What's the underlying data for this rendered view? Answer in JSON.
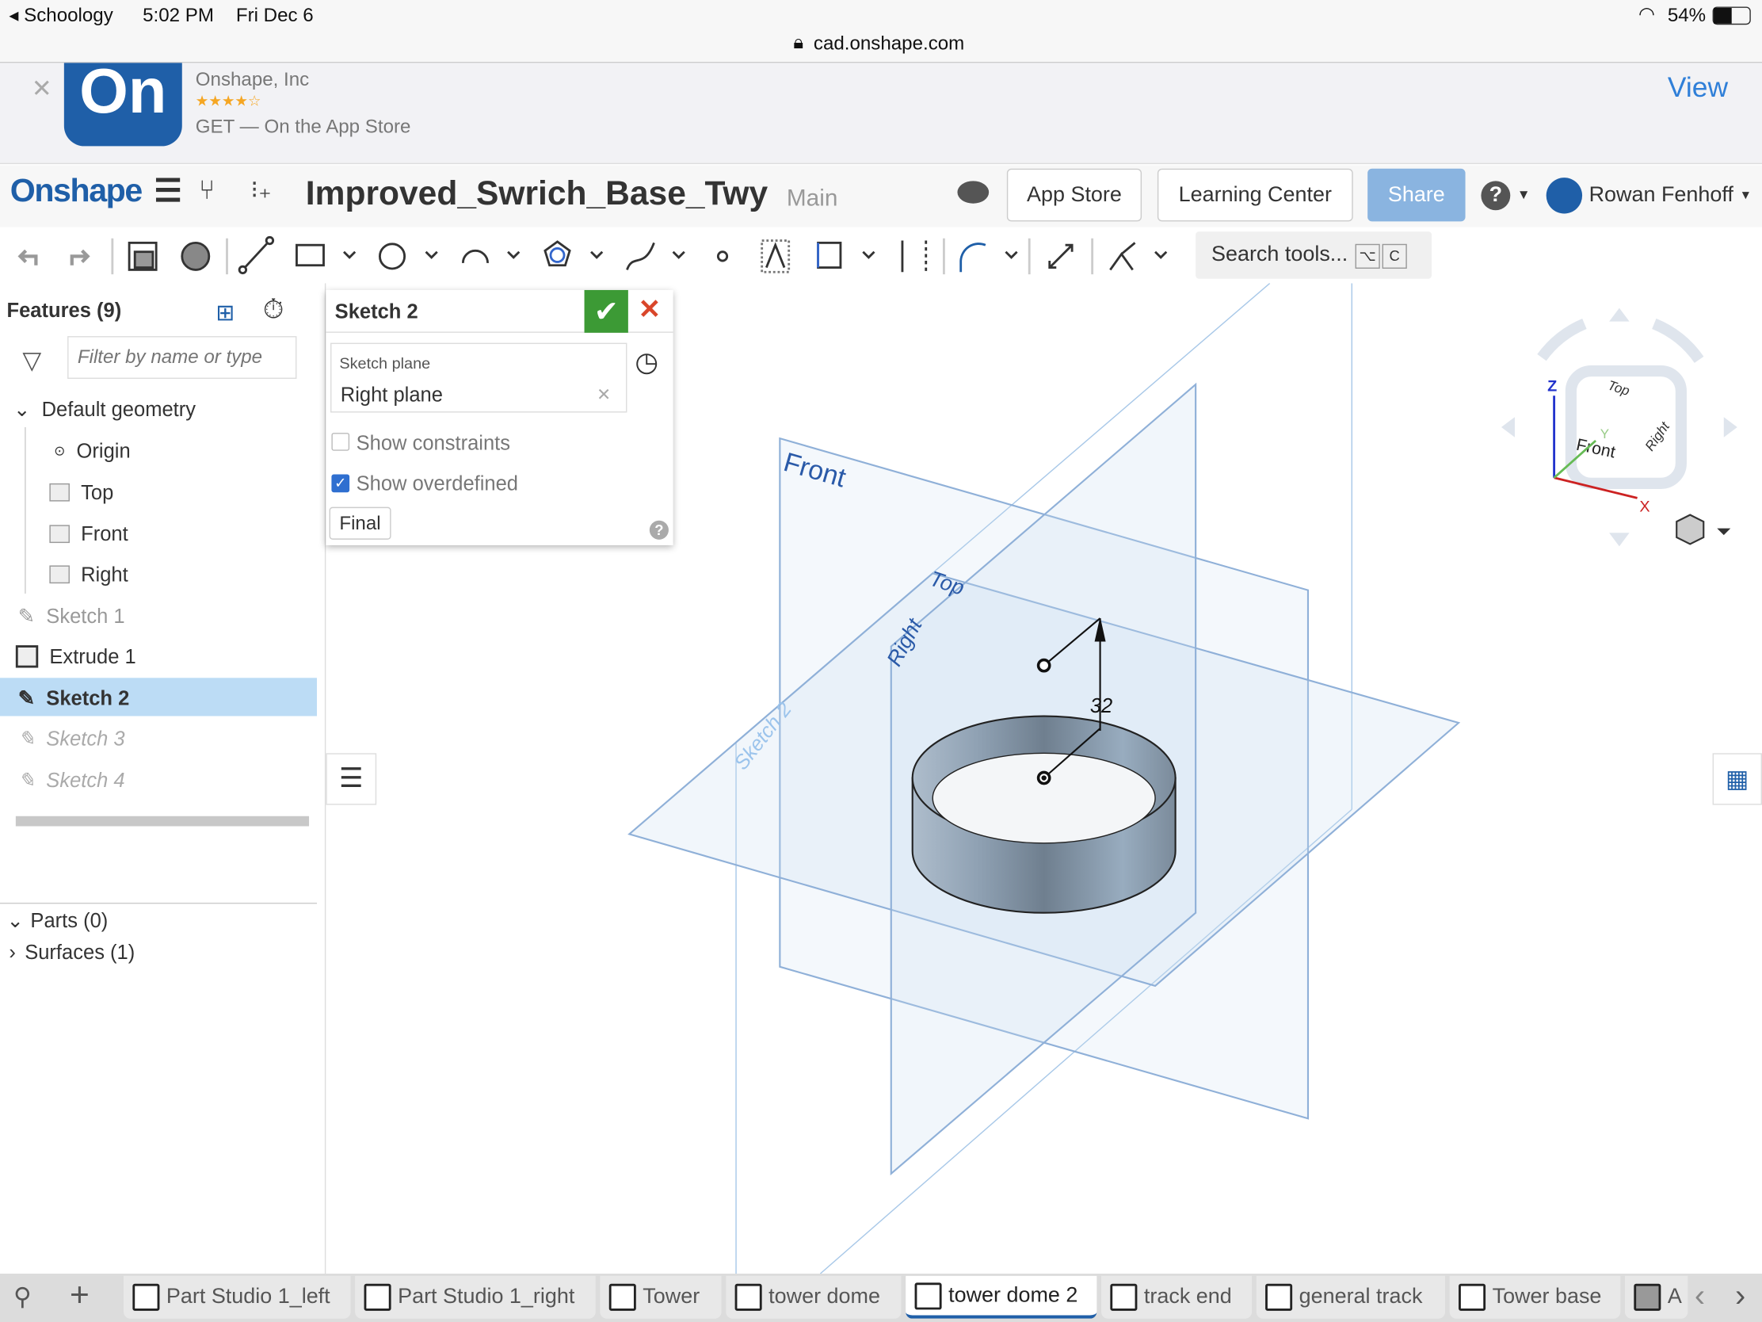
{
  "status_bar": {
    "back_app": "◂ Schoology",
    "time": "5:02 PM",
    "date": "Fri Dec 6",
    "battery": "54%",
    "url": "cad.onshape.com"
  },
  "banner": {
    "app_name": "Onshape, Inc",
    "rating_stars": "★★★★☆",
    "rating": 3.5,
    "subtitle": "GET — On the App Store",
    "view": "View",
    "icon_text": "On"
  },
  "header": {
    "logo": "Onshape",
    "title": "Improved_Swrich_Base_Twy",
    "branch": "Main",
    "app_store": "App Store",
    "learning_center": "Learning Center",
    "share": "Share",
    "user": "Rowan Fenhoff"
  },
  "toolbar": {
    "search": "Search tools...",
    "shortcut_alt": "⌥",
    "shortcut_key": "C"
  },
  "features": {
    "title": "Features (9)",
    "filter_placeholder": "Filter by name or type",
    "items": [
      {
        "label": "Default geometry"
      },
      {
        "label": "Origin"
      },
      {
        "label": "Top"
      },
      {
        "label": "Front"
      },
      {
        "label": "Right"
      },
      {
        "label": "Sketch 1"
      },
      {
        "label": "Extrude 1"
      },
      {
        "label": "Sketch 2"
      },
      {
        "label": "Sketch 3"
      },
      {
        "label": "Sketch 4"
      }
    ],
    "parts": "Parts (0)",
    "surfaces": "Surfaces (1)"
  },
  "dialog": {
    "title": "Sketch 2",
    "plane_label": "Sketch plane",
    "plane_value": "Right plane",
    "show_constraints": "Show constraints",
    "show_constraints_checked": false,
    "show_overdefined": "Show overdefined",
    "show_overdefined_checked": true,
    "final": "Final"
  },
  "viewport": {
    "plane_front": "Front",
    "plane_top": "Top",
    "plane_right": "Right",
    "sketch_label": "Sketch 2",
    "dimension": "32",
    "cube": {
      "top": "Top",
      "front": "Front",
      "right": "Right",
      "x": "X",
      "y": "Y",
      "z": "Z"
    }
  },
  "tabs": [
    {
      "label": "Part Studio 1_left"
    },
    {
      "label": "Part Studio 1_right"
    },
    {
      "label": "Tower"
    },
    {
      "label": "tower dome"
    },
    {
      "label": "tower dome 2",
      "active": true
    },
    {
      "label": "track end"
    },
    {
      "label": "general track"
    },
    {
      "label": "Tower base"
    },
    {
      "label": "A"
    }
  ],
  "colors": {
    "brand": "#1f5fa8",
    "accept": "#3c9a35",
    "cancel": "#d9462a",
    "selected": "#bcdcf5",
    "share": "#8ab4e0"
  }
}
